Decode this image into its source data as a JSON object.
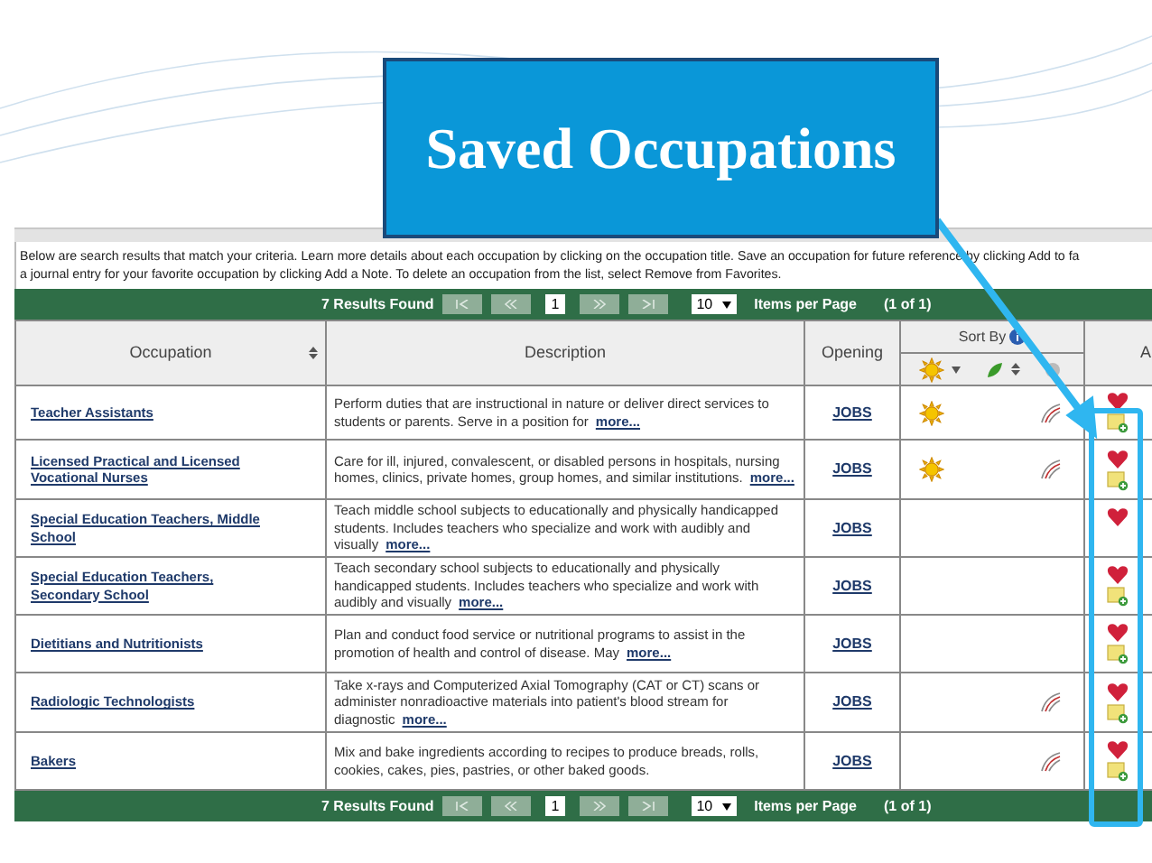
{
  "callout": {
    "title": "Saved Occupations"
  },
  "intro": "Below are search results that match your criteria. Learn more details about each occupation by clicking on the occupation title. Save an occupation for future reference by clicking Add to fa",
  "intro_line_2": "a journal entry for your favorite occupation by clicking Add a Note. To delete an occupation from the list, select Remove from Favorites.",
  "pager_top": {
    "results": "7 Results Found",
    "page": "1",
    "per_page": "10",
    "per_page_label": "Items per Page",
    "page_of": "(1 of 1)"
  },
  "columns": {
    "occupation": "Occupation",
    "description": "Description",
    "opening": "Opening",
    "sort_by": "Sort By",
    "actions": "A"
  },
  "rows": [
    {
      "title": "Teacher Assistants",
      "description": "Perform duties that are instructional in nature or deliver direct services to students or parents. Serve in a position for",
      "more": "more...",
      "opening": "JOBS",
      "sun": true,
      "outlook": true,
      "note": true
    },
    {
      "title": "Licensed Practical and Licensed Vocational Nurses",
      "description": "Care for ill, injured, convalescent, or disabled persons in hospitals, nursing homes, clinics, private homes, group homes, and similar institutions.",
      "more": "more...",
      "opening": "JOBS",
      "sun": true,
      "outlook": true,
      "note": true
    },
    {
      "title": "Special Education Teachers, Middle School",
      "description": "Teach middle school subjects to educationally and physically handicapped students. Includes teachers who specialize and work with audibly and visually",
      "more": "more...",
      "opening": "JOBS",
      "sun": false,
      "outlook": false,
      "note": false
    },
    {
      "title": "Special Education Teachers, Secondary School",
      "description": "Teach secondary school subjects to educationally and physically handicapped students. Includes teachers who specialize and work with audibly and visually",
      "more": "more...",
      "opening": "JOBS",
      "sun": false,
      "outlook": false,
      "note": true
    },
    {
      "title": "Dietitians and Nutritionists",
      "description": "Plan and conduct food service or nutritional programs to assist in the promotion of health and control of disease. May",
      "more": "more...",
      "opening": "JOBS",
      "sun": false,
      "outlook": false,
      "note": true
    },
    {
      "title": "Radiologic Technologists",
      "description": "Take x-rays and Computerized Axial Tomography (CAT or CT) scans or administer nonradioactive materials into patient's blood stream for diagnostic",
      "more": "more...",
      "opening": "JOBS",
      "sun": false,
      "outlook": true,
      "note": true
    },
    {
      "title": "Bakers",
      "description": "Mix and bake ingredients according to recipes to produce breads, rolls, cookies, cakes, pies, pastries, or other baked goods.",
      "more": "",
      "opening": "JOBS",
      "sun": false,
      "outlook": true,
      "note": true
    }
  ],
  "pager_bottom": {
    "results": "7 Results Found",
    "page": "1",
    "per_page": "10",
    "per_page_label": "Items per Page",
    "page_of": "(1 of 1)"
  }
}
